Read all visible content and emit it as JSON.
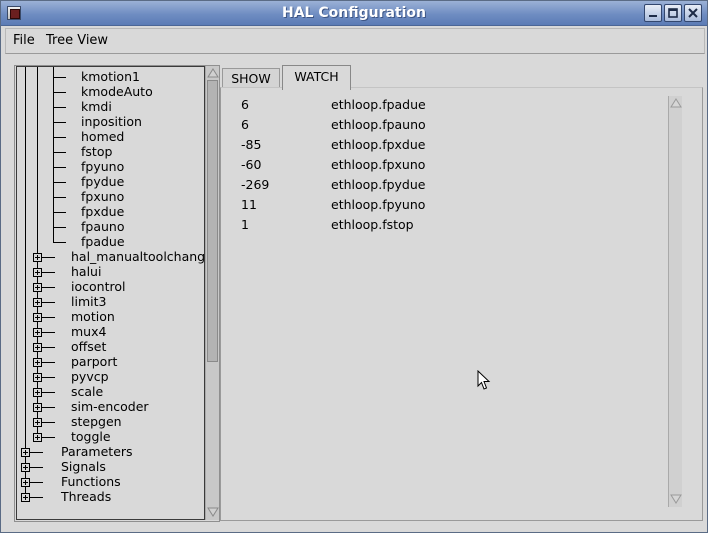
{
  "window": {
    "title": "HAL Configuration"
  },
  "menu": {
    "file": "File",
    "tree_view": "Tree View"
  },
  "tree": {
    "kmotion_children": [
      "kmotion1",
      "kmodeAuto",
      "kmdi",
      "inposition",
      "homed",
      "fstop",
      "fpyuno",
      "fpydue",
      "fpxuno",
      "fpxdue",
      "fpauno",
      "fpadue"
    ],
    "components": [
      "hal_manualtoolchange",
      "halui",
      "iocontrol",
      "limit3",
      "motion",
      "mux4",
      "offset",
      "parport",
      "pyvcp",
      "scale",
      "sim-encoder",
      "stepgen",
      "toggle"
    ],
    "top_level": [
      "Parameters",
      "Signals",
      "Functions",
      "Threads"
    ]
  },
  "tabs": {
    "show": "SHOW",
    "watch": "WATCH"
  },
  "watch": [
    {
      "value": "6",
      "name": "ethloop.fpadue"
    },
    {
      "value": "6",
      "name": "ethloop.fpauno"
    },
    {
      "value": "-85",
      "name": "ethloop.fpxdue"
    },
    {
      "value": "-60",
      "name": "ethloop.fpxuno"
    },
    {
      "value": "-269",
      "name": "ethloop.fpydue"
    },
    {
      "value": "11",
      "name": "ethloop.fpyuno"
    },
    {
      "value": "1",
      "name": "ethloop.fstop"
    }
  ]
}
